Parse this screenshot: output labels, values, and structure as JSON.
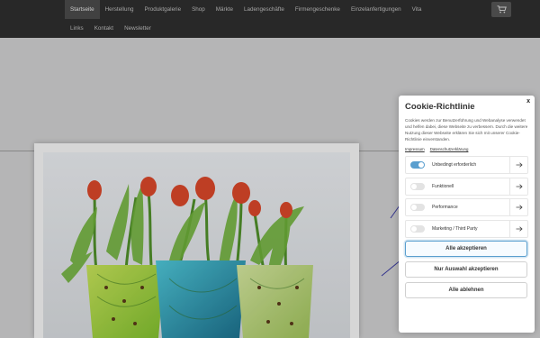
{
  "nav": {
    "row1": [
      "Startseite",
      "Herstellung",
      "Produktgalerie",
      "Shop",
      "Märkte",
      "Ladengeschäfte",
      "Firmengeschenke",
      "Einzelanfertigungen",
      "Vita"
    ],
    "row2": [
      "Links",
      "Kontakt",
      "Newsletter"
    ],
    "active_index": 0,
    "cart_icon": "shopping-cart-icon"
  },
  "cookie": {
    "title": "Cookie-Richtlinie",
    "close": "x",
    "text": "Cookies werden zur Benutzerführung und Webanalyse verwendet und helfen dabei, diese Webseite zu verbessern. Durch die weitere Nutzung dieser Webseite erklären Sie sich mit unserer Cookie-Richtlinie einverstanden.",
    "links": [
      "Impressum",
      "Datenschutzerklärung"
    ],
    "categories": [
      {
        "label": "Unbedingt erforderlich",
        "enabled": true
      },
      {
        "label": "Funktionell",
        "enabled": false
      },
      {
        "label": "Performance",
        "enabled": false
      },
      {
        "label": "Marketing / Third Party",
        "enabled": false
      }
    ],
    "buttons": {
      "accept_all": "Alle akzeptieren",
      "accept_selection": "Nur Auswahl akzeptieren",
      "reject_all": "Alle ablehnen"
    }
  },
  "colors": {
    "nav_bg": "#2e2e2e",
    "accent": "#5a9fcf"
  }
}
